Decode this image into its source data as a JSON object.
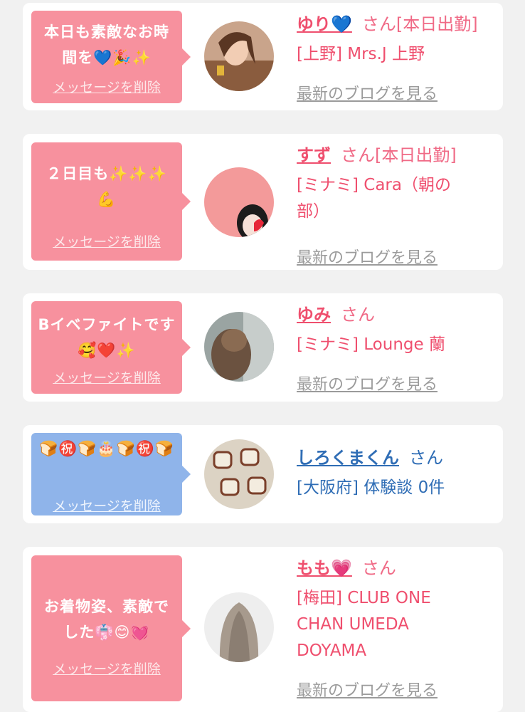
{
  "cards": [
    {
      "message": "本日も素敵なお時間を💙🎉✨",
      "delete_label": "メッセージを削除",
      "name": "ゆり💙",
      "san": "さん",
      "status": "[本日出勤]",
      "shop": "[上野] Mrs.J 上野",
      "blog_label": "最新のブログを見る"
    },
    {
      "message": "２日目も✨✨✨💪",
      "delete_label": "メッセージを削除",
      "name": "すず",
      "san": "さん",
      "status": "[本日出勤]",
      "shop": "[ミナミ] Cara（朝の部）",
      "blog_label": "最新のブログを見る"
    },
    {
      "message": "Bイベファイトです🥰❤️✨",
      "delete_label": "メッセージを削除",
      "name": "ゆみ",
      "san": "さん",
      "status": "",
      "shop": "[ミナミ] Lounge 蘭",
      "blog_label": "最新のブログを見る"
    },
    {
      "message": "🍞㊗️🍞🎂🍞㊗️🍞",
      "delete_label": "メッセージを削除",
      "name": "しろくまくん",
      "san": "さん",
      "status": "",
      "shop": "[大阪府] 体験談 0件",
      "blog_label": ""
    },
    {
      "message": "お着物姿、素敵でした👘😊💓",
      "delete_label": "メッセージを削除",
      "name": "もも💗",
      "san": "さん",
      "status": "",
      "shop": "[梅田] CLUB ONE CHAN UMEDA DOYAMA",
      "blog_label": "最新のブログを見る"
    }
  ],
  "colors": {
    "pink_accent": "#ef4f6e",
    "pink_bubble": "#f7919e",
    "blue_accent": "#2f6db5",
    "blue_bubble": "#8fb4ea"
  }
}
